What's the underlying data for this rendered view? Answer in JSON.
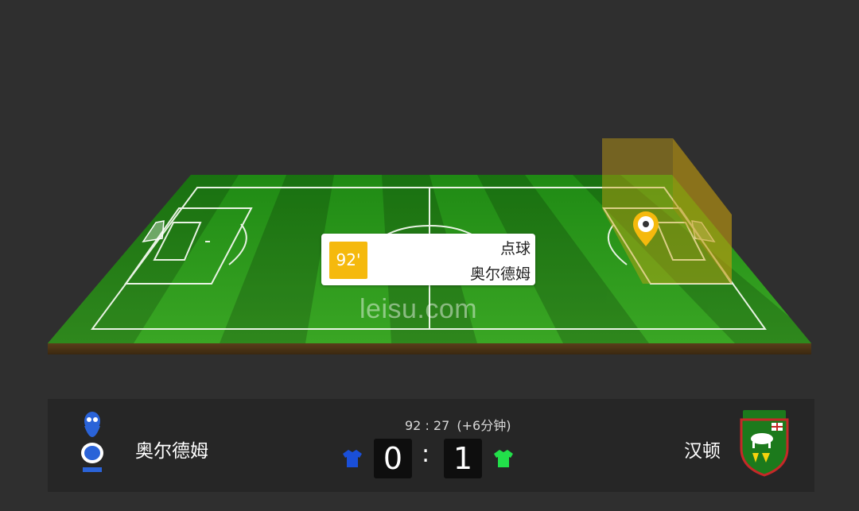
{
  "event": {
    "minute": "92'",
    "type": "点球",
    "team": "奥尔德姆"
  },
  "watermark": "leisu.com",
  "match": {
    "clock": "92 : 27",
    "added_time": "(+6分钟)",
    "home": {
      "name": "奥尔德姆",
      "score": "0",
      "jersey_color": "#1a4fd8",
      "logo_icon": "owl-crest-icon"
    },
    "away": {
      "name": "汉顿",
      "score": "1",
      "jersey_color": "#22e04a",
      "logo_icon": "hendon-fc-crest-icon"
    },
    "separator": ":"
  },
  "colors": {
    "background": "#2f2f2f",
    "pitch_green": "#2e9a1f",
    "highlight_zone": "#c9a313",
    "marker": "#f5b90d"
  }
}
